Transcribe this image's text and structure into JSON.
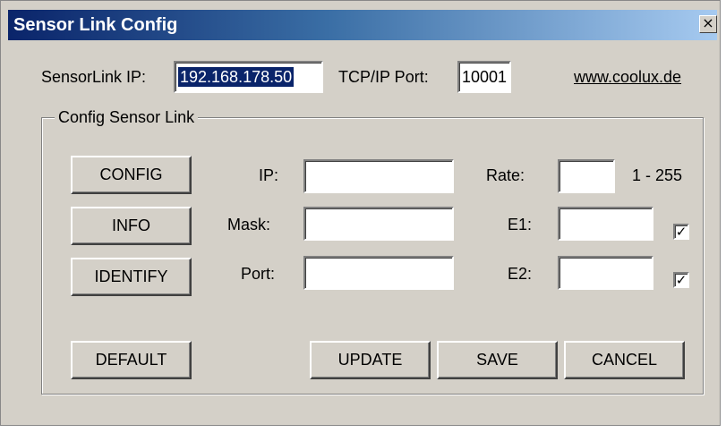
{
  "window": {
    "title": "Sensor Link Config",
    "close_glyph": "×"
  },
  "top": {
    "ip_label": "SensorLink IP:",
    "ip_value": "192.168.178.50",
    "port_label": "TCP/IP Port:",
    "port_value": "10001",
    "link": "www.coolux.de"
  },
  "group": {
    "label": "Config Sensor Link",
    "buttons": {
      "config": "CONFIG",
      "info": "INFO",
      "identify": "IDENTIFY",
      "default": "DEFAULT",
      "update": "UPDATE",
      "save": "SAVE",
      "cancel": "CANCEL"
    },
    "fields": {
      "ip": {
        "label": "IP:",
        "value": ""
      },
      "mask": {
        "label": "Mask:",
        "value": ""
      },
      "port": {
        "label": "Port:",
        "value": ""
      },
      "rate": {
        "label": "Rate:",
        "value": "",
        "hint": "1 - 255"
      },
      "e1": {
        "label": "E1:",
        "value": "",
        "checked": true
      },
      "e2": {
        "label": "E2:",
        "value": "",
        "checked": true
      }
    },
    "check_glyph": "✓"
  },
  "colors": {
    "face": "#d4d0c8",
    "title_start": "#0a246a",
    "title_end": "#a6caf0",
    "selection": "#0a246a"
  }
}
